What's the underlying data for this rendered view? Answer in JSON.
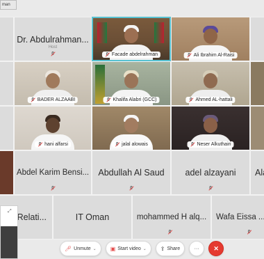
{
  "corner_label": "man",
  "tiles": {
    "dr_abdulrahman": {
      "name": "Dr. Abdulrahman...",
      "role": "Host"
    },
    "facade": {
      "name": "Facade abdelrahman"
    },
    "ali_ibrahim": {
      "name": "Ali Ibrahim Al-Raisi"
    },
    "bader": {
      "name": "BADER ALZAABI"
    },
    "khalifa": {
      "name": "Khalifa Alabri (GCC)"
    },
    "ahmed": {
      "name": "Ahmed AL-hattali"
    },
    "hani": {
      "name": "hani alfarsi"
    },
    "jalal": {
      "name": "jalal alowais"
    },
    "neser": {
      "name": "Neser Alkuthairi"
    },
    "abdel_karim": {
      "name": "Abdel Karim Bensi..."
    },
    "abdullah": {
      "name": "Abdullah Al Saud"
    },
    "adel": {
      "name": "adel alzayani"
    },
    "ala": {
      "name": "Ala"
    },
    "al_relati": {
      "name": "al Relati..."
    },
    "it_oman": {
      "name": "IT Oman"
    },
    "mohammed": {
      "name": "mohammed H alq..."
    },
    "wafa": {
      "name": "Wafa Eissa ...I"
    }
  },
  "toolbar": {
    "unmute": "Unmute",
    "start_video": "Start video",
    "share": "Share",
    "more": "···"
  },
  "colors": {
    "end_button": "#e53a30",
    "active_border": "#57c2d2"
  }
}
